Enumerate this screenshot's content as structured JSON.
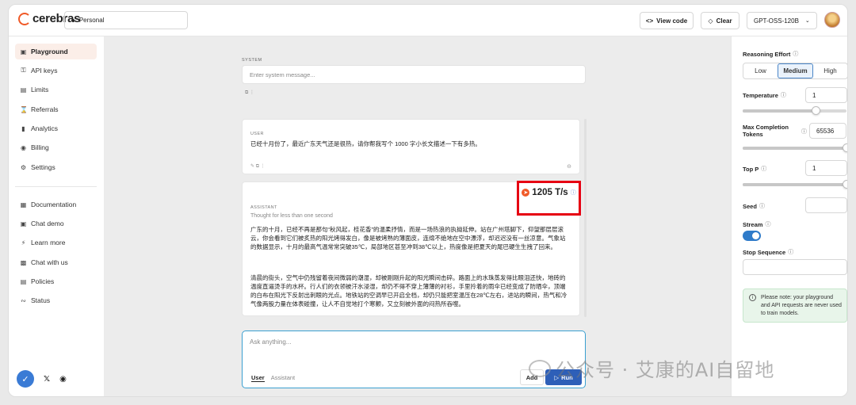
{
  "brand": {
    "name": "cerebras"
  },
  "topbar": {
    "workspace": "Personal",
    "view_code": "View code",
    "clear": "Clear",
    "model": "GPT-OSS-120B"
  },
  "sidebar": {
    "items": [
      {
        "label": "Playground",
        "icon": "square-icon"
      },
      {
        "label": "API keys",
        "icon": "key-icon"
      },
      {
        "label": "Limits",
        "icon": "limits-icon"
      },
      {
        "label": "Referrals",
        "icon": "gift-icon"
      },
      {
        "label": "Analytics",
        "icon": "chart-icon"
      },
      {
        "label": "Billing",
        "icon": "billing-icon"
      },
      {
        "label": "Settings",
        "icon": "gear-icon"
      }
    ],
    "links": [
      {
        "label": "Documentation",
        "icon": "book-icon"
      },
      {
        "label": "Chat demo",
        "icon": "chat-icon"
      },
      {
        "label": "Learn more",
        "icon": "bolt-icon"
      },
      {
        "label": "Chat with us",
        "icon": "message-icon"
      },
      {
        "label": "Policies",
        "icon": "doc-icon"
      },
      {
        "label": "Status",
        "icon": "status-icon"
      }
    ]
  },
  "system": {
    "label": "SYSTEM",
    "placeholder": "Enter system message..."
  },
  "user_msg": {
    "role": "USER",
    "text": "已经十月份了，最近广东天气还是很热，请你帮我写个 1000 字小长文描述一下有多热。"
  },
  "assistant_msg": {
    "role": "ASSISTANT",
    "thought": "Thought for less than one second",
    "para1": "广东的十月，已经不再是那句“秋风起，桂花香”的温柔抒情，而是一场热浪的执拗延伸。站在广州塔脚下，仰望那层层滚云，你会看到它们被炙热的阳光烤得发白，像是被烤熟的薄面皮，连绵不绝地在空中漂浮，却迟迟没有一丝凉意。气象站的数据显示，十月的最高气温常常突破35℃，局部地区甚至冲到38℃以上，热度像是把夏天的尾巴硬生生拽了回来。",
    "para2": "清晨的街头，空气中仍残留着夜间微弱的潮湿，却被刚刚升起的阳光瞬间击碎。路面上的水珠蒸发得比眼泪还快，地砖的温度直逼烫手的水杯。行人们的衣领被汗水浸湿，却仍不得不穿上薄薄的衬衫，手里拎着的雨伞已经变成了防晒伞，顶端的白布在阳光下反射出刺眼的光点。地铁站的空调早已开启全档，却仍只能把室温压在28℃左右，进站的瞬间，热气和冷气像两股力量在体表碰撞，让人不自觉地打个寒颤，又立刻被外面的闷热所吞噬。"
  },
  "speed": {
    "value": "1205 T/s"
  },
  "composer": {
    "placeholder": "Ask anything...",
    "tab_user": "User",
    "tab_assistant": "Assistant",
    "add": "Add",
    "run": "Run"
  },
  "settings": {
    "reasoning_effort": {
      "label": "Reasoning Effort",
      "options": [
        "Low",
        "Medium",
        "High"
      ],
      "selected": "Medium"
    },
    "temperature": {
      "label": "Temperature",
      "value": "1",
      "slider": 0.7
    },
    "max_tokens": {
      "label": "Max Completion Tokens",
      "value": "65536",
      "slider": 1.0
    },
    "top_p": {
      "label": "Top P",
      "value": "1",
      "slider": 1.0
    },
    "seed": {
      "label": "Seed",
      "value": ""
    },
    "stream": {
      "label": "Stream",
      "on": true
    },
    "stop_sequence": {
      "label": "Stop Sequence"
    },
    "note": "Please note: your playground and API requests are never used to train models."
  },
  "watermark": "公众号 · 艾康的AI自留地",
  "colors": {
    "accent": "#f05a28",
    "primary": "#2e5fb8",
    "highlight": "#e60012"
  }
}
